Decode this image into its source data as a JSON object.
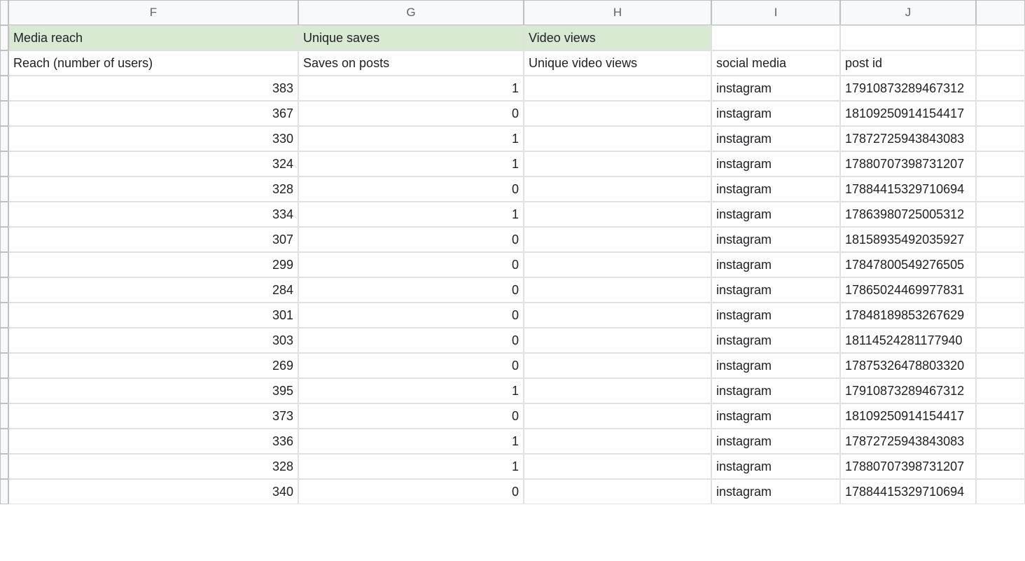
{
  "columns": [
    "F",
    "G",
    "H",
    "I",
    "J",
    ""
  ],
  "headerRow1": {
    "F": "Media reach",
    "G": "Unique saves",
    "H": "Video views",
    "I": "",
    "J": ""
  },
  "headerRow2": {
    "F": "Reach (number of users)",
    "G": "Saves on posts",
    "H": "Unique video views",
    "I": "social media",
    "J": "post id"
  },
  "rows": [
    {
      "F": "383",
      "G": "1",
      "H": "",
      "I": "instagram",
      "J": "17910873289467312"
    },
    {
      "F": "367",
      "G": "0",
      "H": "",
      "I": "instagram",
      "J": "18109250914154417"
    },
    {
      "F": "330",
      "G": "1",
      "H": "",
      "I": "instagram",
      "J": "17872725943843083"
    },
    {
      "F": "324",
      "G": "1",
      "H": "",
      "I": "instagram",
      "J": "17880707398731207"
    },
    {
      "F": "328",
      "G": "0",
      "H": "",
      "I": "instagram",
      "J": "17884415329710694"
    },
    {
      "F": "334",
      "G": "1",
      "H": "",
      "I": "instagram",
      "J": "17863980725005312"
    },
    {
      "F": "307",
      "G": "0",
      "H": "",
      "I": "instagram",
      "J": "18158935492035927"
    },
    {
      "F": "299",
      "G": "0",
      "H": "",
      "I": "instagram",
      "J": "17847800549276505"
    },
    {
      "F": "284",
      "G": "0",
      "H": "",
      "I": "instagram",
      "J": "17865024469977831"
    },
    {
      "F": "301",
      "G": "0",
      "H": "",
      "I": "instagram",
      "J": "17848189853267629"
    },
    {
      "F": "303",
      "G": "0",
      "H": "",
      "I": "instagram",
      "J": "18114524281177940"
    },
    {
      "F": "269",
      "G": "0",
      "H": "",
      "I": "instagram",
      "J": "17875326478803320"
    },
    {
      "F": "395",
      "G": "1",
      "H": "",
      "I": "instagram",
      "J": "17910873289467312"
    },
    {
      "F": "373",
      "G": "0",
      "H": "",
      "I": "instagram",
      "J": "18109250914154417"
    },
    {
      "F": "336",
      "G": "1",
      "H": "",
      "I": "instagram",
      "J": "17872725943843083"
    },
    {
      "F": "328",
      "G": "1",
      "H": "",
      "I": "instagram",
      "J": "17880707398731207"
    },
    {
      "F": "340",
      "G": "0",
      "H": "",
      "I": "instagram",
      "J": "17884415329710694"
    }
  ],
  "colors": {
    "headerGreen": "#d9ead3",
    "gridBorder": "#e1e1e1",
    "colHeaderBg": "#f8f9fa"
  }
}
